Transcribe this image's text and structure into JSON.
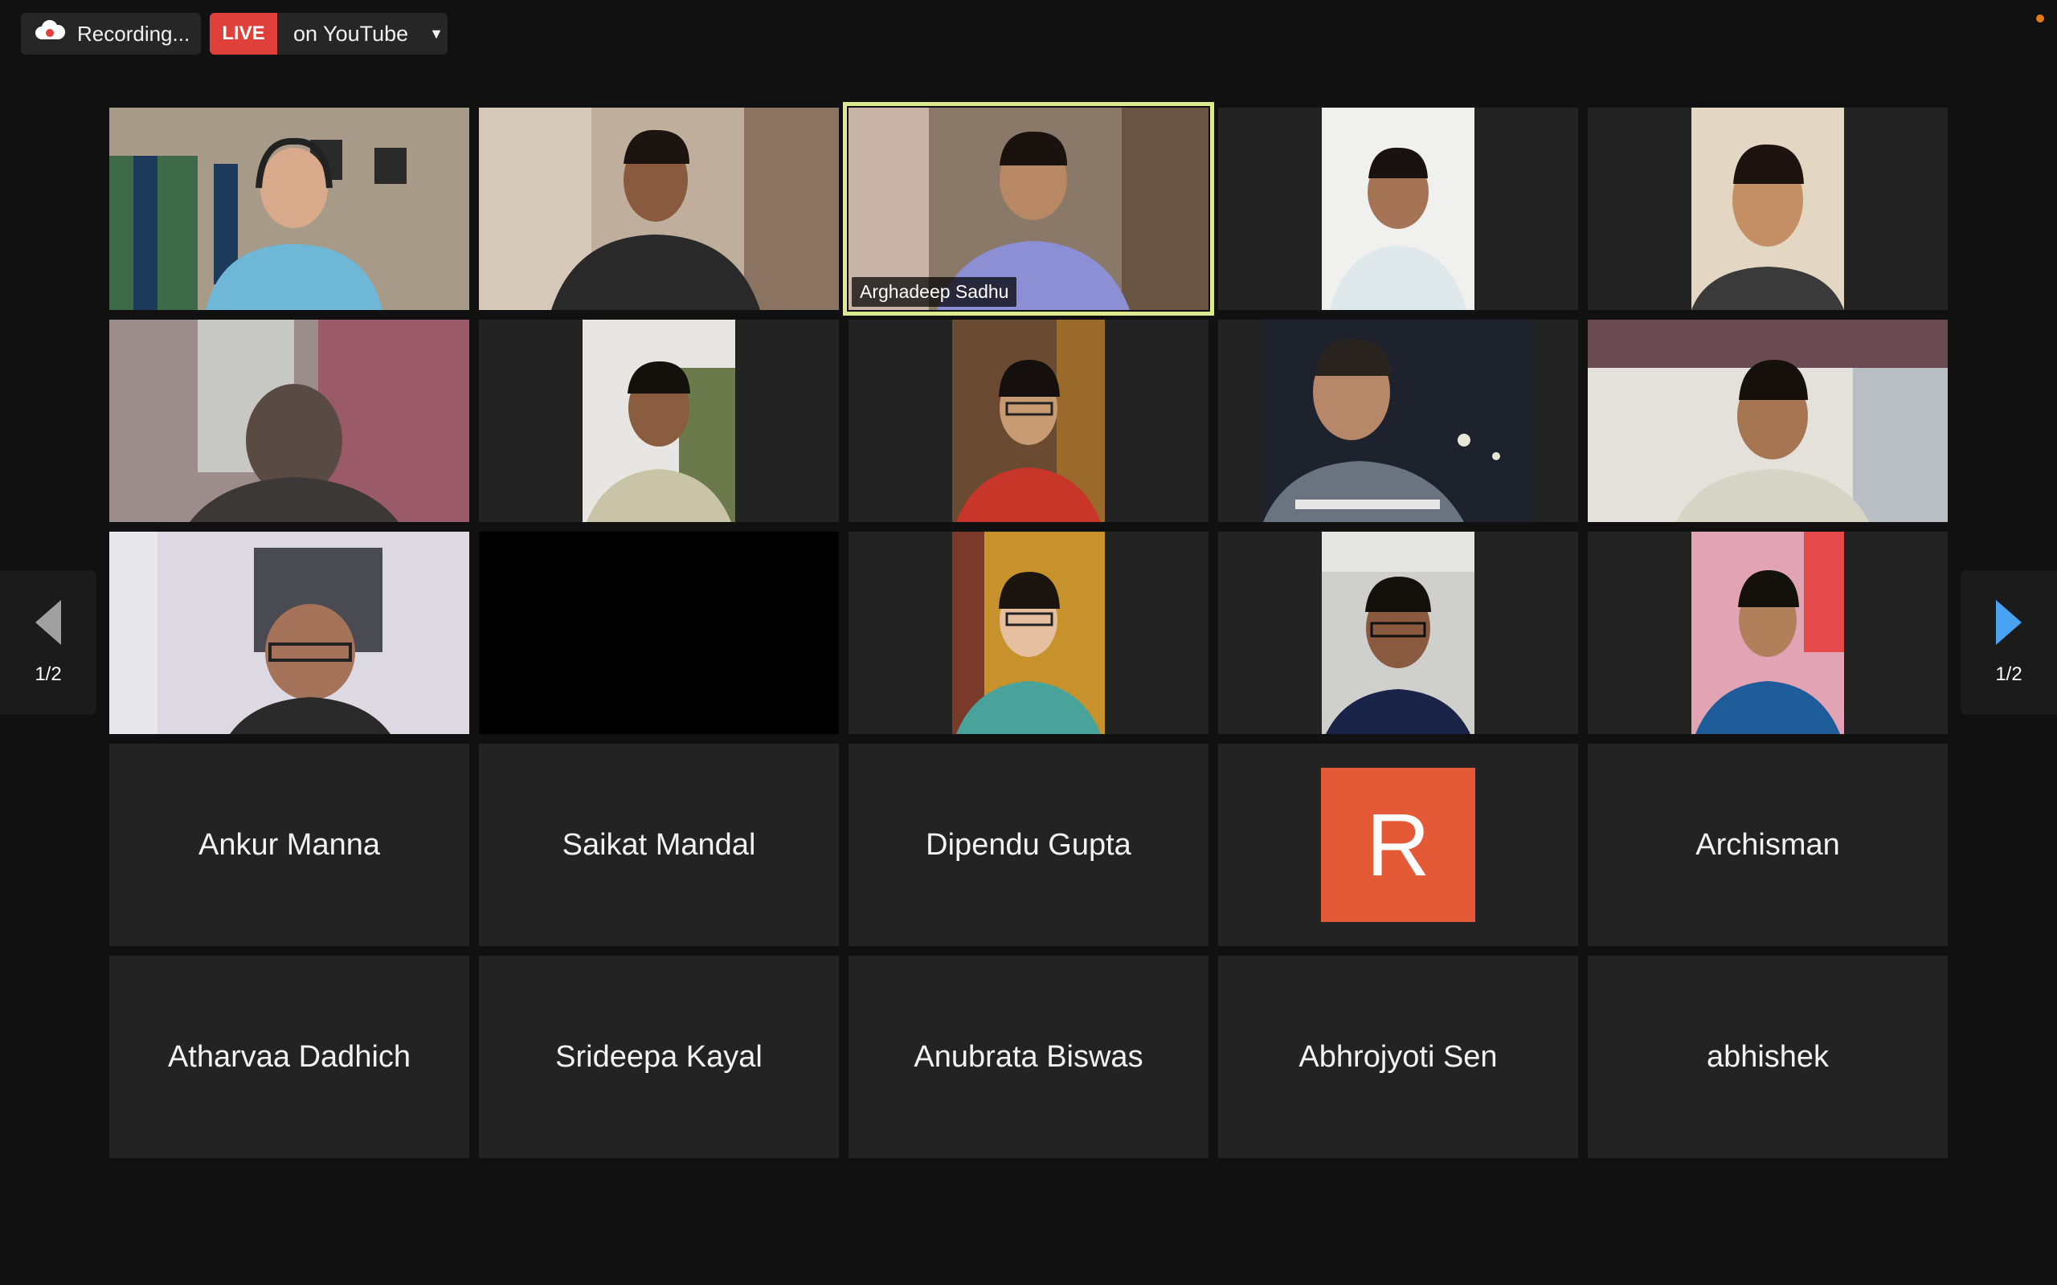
{
  "toolbar": {
    "recording_label": "Recording...",
    "live_badge": "LIVE",
    "live_target": "on YouTube",
    "dropdown_caret": "▼"
  },
  "pagination": {
    "left_label": "1/2",
    "right_label": "1/2"
  },
  "colors": {
    "active_border": "#ddea8e",
    "live_red": "#e0403a",
    "avatar_orange": "#e55a36",
    "nav_arrow_right": "#4aa3f0"
  },
  "participants_video": [
    {
      "id": "p1",
      "name": ""
    },
    {
      "id": "p2",
      "name": ""
    },
    {
      "id": "p3",
      "name": "Arghadeep Sadhu",
      "active_speaker": true
    },
    {
      "id": "p4",
      "name": ""
    },
    {
      "id": "p5",
      "name": ""
    },
    {
      "id": "p6",
      "name": ""
    },
    {
      "id": "p7",
      "name": ""
    },
    {
      "id": "p8",
      "name": ""
    },
    {
      "id": "p9",
      "name": ""
    },
    {
      "id": "p10",
      "name": ""
    },
    {
      "id": "p11",
      "name": ""
    },
    {
      "id": "p12",
      "name": ""
    },
    {
      "id": "p13",
      "name": ""
    },
    {
      "id": "p14",
      "name": ""
    },
    {
      "id": "p15",
      "name": ""
    }
  ],
  "participants_no_video": [
    "Ankur Manna",
    "Saikat Mandal",
    "Dipendu Gupta",
    "R",
    "Archisman",
    "Atharvaa Dadhich",
    "Srideepa Kayal",
    "Anubrata Biswas",
    "Abhrojyoti Sen",
    "abhishek"
  ]
}
